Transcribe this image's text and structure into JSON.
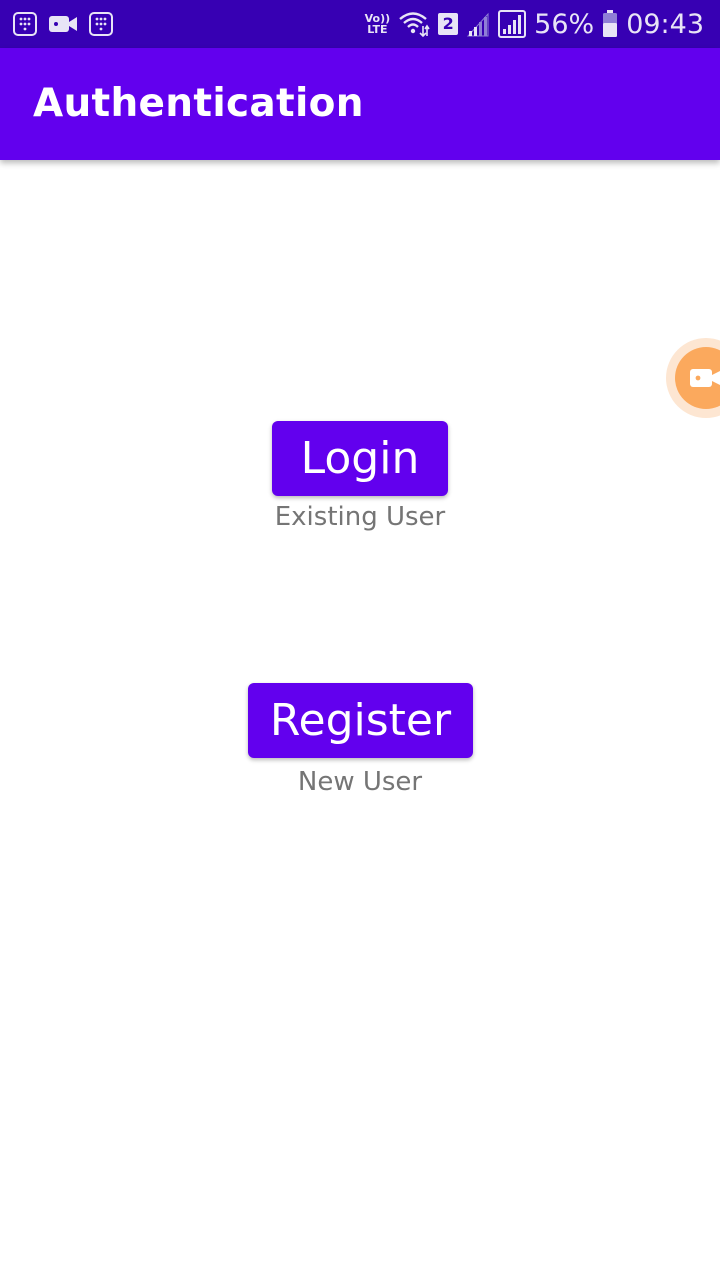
{
  "status_bar": {
    "icons_left": [
      "dialpad-icon",
      "video-camera-icon",
      "dialpad-icon"
    ],
    "volte_top": "Vo))",
    "volte_bottom": "LTE",
    "sim_slot": "2",
    "battery_percent": "56%",
    "time": "09:43"
  },
  "app_bar": {
    "title": "Authentication"
  },
  "login": {
    "button_label": "Login",
    "caption": "Existing User"
  },
  "register": {
    "button_label": "Register",
    "caption": "New User"
  },
  "floating_button": {
    "icon": "video-camera-icon"
  },
  "colors": {
    "status_bar": "#3700b3",
    "primary": "#6200ee",
    "caption_text": "#757575",
    "floating_button": "#fba95d"
  }
}
